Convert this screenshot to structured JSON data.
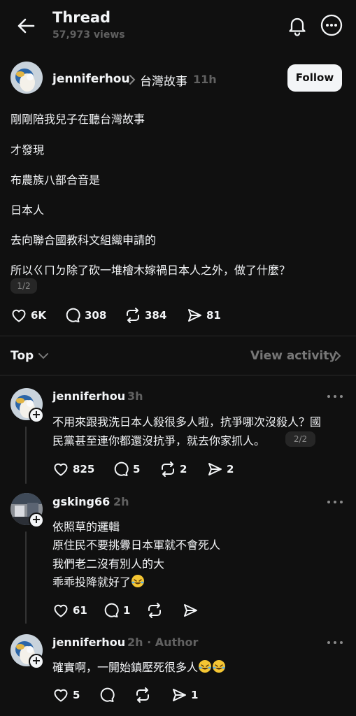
{
  "header": {
    "title": "Thread",
    "views": "57,973 views"
  },
  "post": {
    "author": "jenniferhou",
    "topic": "台灣故事",
    "time": "11h",
    "follow_label": "Follow",
    "lines": [
      "剛剛陪我兒子在聽台灣故事",
      "才發現",
      "布農族八部合音是",
      "日本人",
      "去向聯合國教科文組織申請的",
      "所以ㄍㄇㄉ除了砍一堆檜木嫁禍日本人之外，做了什麼？"
    ],
    "pager": "1/2",
    "likes": "6K",
    "comments": "308",
    "reposts": "384",
    "shares": "81"
  },
  "sort": {
    "label": "Top",
    "view_activity": "View activity"
  },
  "comments": [
    {
      "author": "jenniferhou",
      "time": "3h",
      "lines": [
        "不用來跟我洗日本人殺很多人啦，抗爭哪次沒殺人？國",
        "民黨甚至連你都還沒抗爭，就去你家抓人。"
      ],
      "pager": "2/2",
      "likes": "825",
      "comments": "5",
      "reposts": "2",
      "shares": "2"
    },
    {
      "author": "gsking66",
      "time": "2h",
      "lines": [
        "依照草的邏輯",
        "原住民不要挑釁日本軍就不會死人",
        "我們老二沒有別人的大",
        "乖乖投降就好了"
      ],
      "likes": "61",
      "comments": "1"
    },
    {
      "author": "jenniferhou",
      "time": "2h · Author",
      "lines": [
        "確實啊，一開始鎮壓死很多人"
      ],
      "likes": "5",
      "shares": "1"
    }
  ],
  "icons": [
    "back-arrow-icon",
    "bell-icon",
    "more-icon",
    "chevron-right-icon",
    "heart-icon",
    "comment-icon",
    "repost-icon",
    "share-icon",
    "chevron-down-icon",
    "dots-icon",
    "plus-icon",
    "rofl-emoji-icon"
  ],
  "colors": {
    "background": "#101010",
    "text": "#f3f5f7",
    "muted": "#616161",
    "divider": "#2a2a2a",
    "follow_bg": "#f3f5f7"
  }
}
